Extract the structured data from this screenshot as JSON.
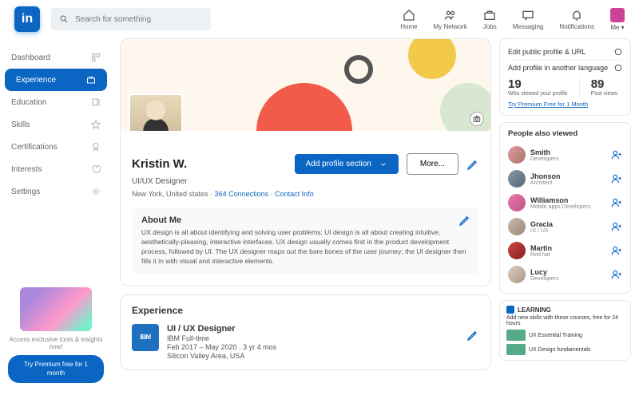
{
  "topbar": {
    "search_placeholder": "Search for something",
    "nav": [
      {
        "label": "Home"
      },
      {
        "label": "My Network"
      },
      {
        "label": "Jobs"
      },
      {
        "label": "Messaging"
      },
      {
        "label": "Notifications"
      },
      {
        "label": "Me ▾"
      }
    ]
  },
  "sidebar": {
    "items": [
      {
        "label": "Dashboard"
      },
      {
        "label": "Experience"
      },
      {
        "label": "Education"
      },
      {
        "label": "Skills"
      },
      {
        "label": "Certifications"
      },
      {
        "label": "Interests"
      },
      {
        "label": "Settings"
      }
    ],
    "promo_text": "Access exclusive tools & insights now!",
    "promo_button": "Try Premium\nfree for 1 month"
  },
  "profile": {
    "name": "Kristin W.",
    "title": "UI/UX Designer",
    "location": "New York, United states",
    "connections": "364 Connections",
    "contact": "Contact Info",
    "add_section": "Add profile section",
    "more": "More...",
    "about_title": "About Me",
    "about_body": "UX design is all about identifying and solving user problems; UI design is all about creating intuitive, aesthetically-pleasing, interactive interfaces. UX design usually comes first in the product development process, followed by UI. The UX designer maps out the bare bones of the user journey; the UI designer then fills it in with visual and interactive elements."
  },
  "experience": {
    "heading": "Experience",
    "items": [
      {
        "company_short": "IBM",
        "title": "UI / UX Designer",
        "company": "IBM Full-time",
        "dates": "Feb 2017 – May 2020  .  3 yr 4 mos",
        "location": "Silicon Valley Area, USA"
      }
    ]
  },
  "rail": {
    "edit_url": "Edit public profile & URL",
    "add_lang": "Add profile in another language",
    "views_n": "19",
    "views_l": "Who viewed your profile",
    "posts_n": "89",
    "posts_l": "Post views",
    "premium": "Try Premium Free for 1 Month",
    "people_title": "People also viewed",
    "people": [
      {
        "name": "Smith",
        "role": "Developers"
      },
      {
        "name": "Jhonson",
        "role": "Architect"
      },
      {
        "name": "Williamson",
        "role": "Mobile apps Developers"
      },
      {
        "name": "Gracia",
        "role": "UI / UX"
      },
      {
        "name": "Martin",
        "role": "Red hat"
      },
      {
        "name": "Lucy",
        "role": "Developers"
      }
    ],
    "learning_brand": "LEARNING",
    "learning_sub": "Add new skills with these courses, free for 24 hours",
    "learning_items": [
      {
        "title": "UX Essential Training"
      },
      {
        "title": "UX Design fundamentals"
      }
    ]
  }
}
